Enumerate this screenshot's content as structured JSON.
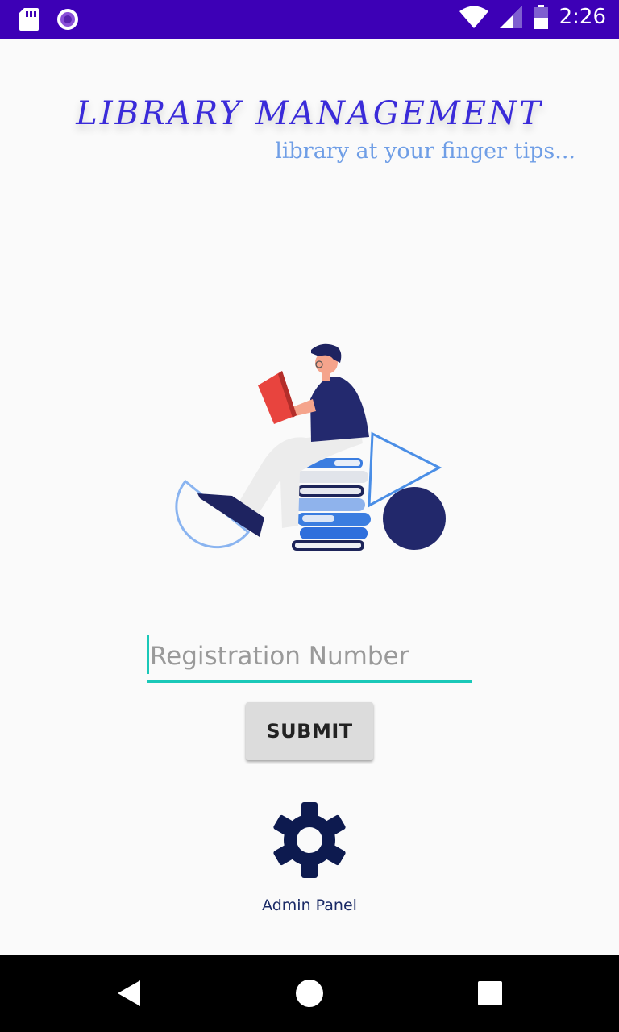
{
  "status_bar": {
    "time": "2:26",
    "icons": [
      "sd-card-icon",
      "record-icon",
      "wifi-icon",
      "signal-icon",
      "battery-icon"
    ]
  },
  "header": {
    "title": "LIBRARY MANAGEMENT",
    "tagline": "library at your finger tips..."
  },
  "registration": {
    "placeholder": "Registration Number",
    "value": ""
  },
  "submit_label": "SUBMIT",
  "admin": {
    "icon": "gear-icon",
    "label": "Admin Panel"
  },
  "navigation": {
    "icons": [
      "back-icon",
      "home-icon",
      "recents-icon"
    ]
  },
  "colors": {
    "status_bar": "#3d00b6",
    "title": "#3a2bd9",
    "tagline": "#6f9ee6",
    "accent": "#1ac8b8",
    "gear": "#0d1a4f"
  }
}
